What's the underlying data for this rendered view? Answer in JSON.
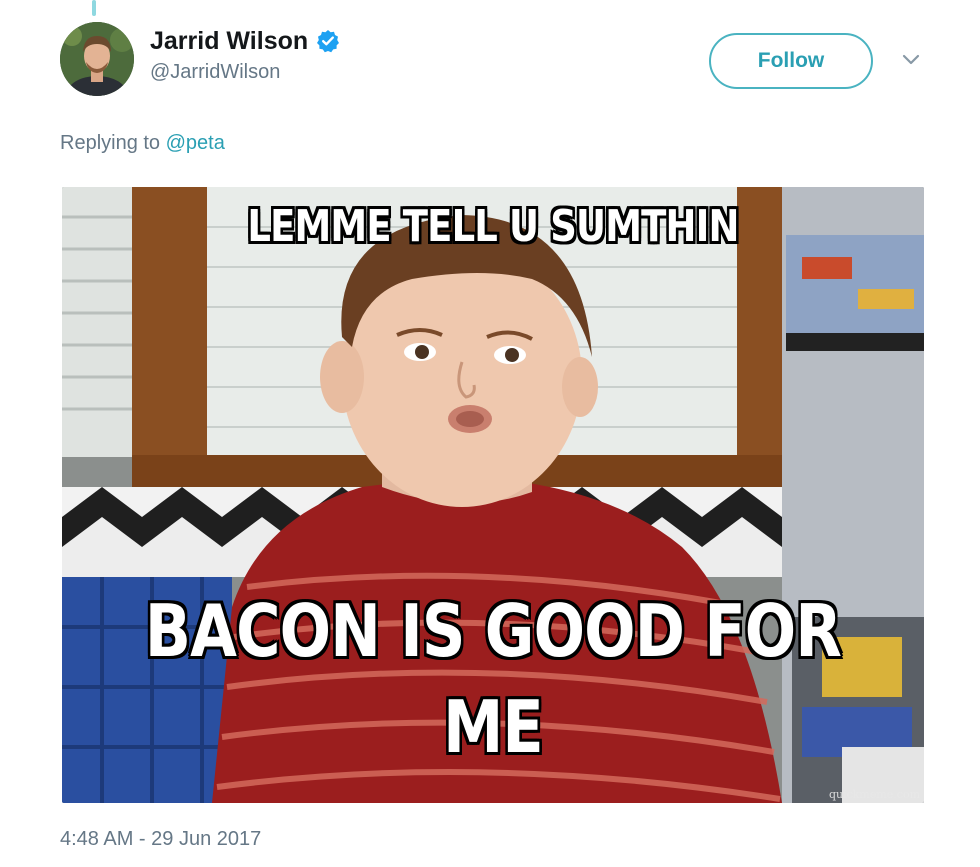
{
  "tweet": {
    "author": {
      "name": "Jarrid Wilson",
      "handle": "@JarridWilson",
      "verified": true
    },
    "follow_label": "Follow",
    "reply": {
      "prefix": "Replying to",
      "mention": "@peta"
    },
    "media": {
      "top_text": "LEMME TELL U SUMTHIN",
      "bottom_text": "BACON IS GOOD FOR ME",
      "watermark": "quickmeme.com"
    },
    "timestamp": "4:48 AM - 29 Jun 2017"
  },
  "colors": {
    "accent": "#4ab3c1",
    "verified": "#1da1f2",
    "muted_text": "#657786"
  },
  "icons": [
    "verified-badge-icon",
    "chevron-down-icon"
  ]
}
